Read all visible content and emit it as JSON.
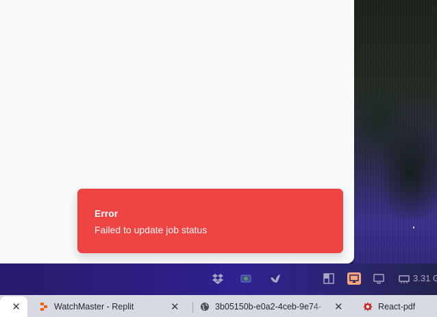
{
  "toast": {
    "title": "Error",
    "description": "Failed to update job status",
    "color": "#ef4444"
  },
  "tray": {
    "icons": [
      "dropbox-icon",
      "screen-capture-icon",
      "bird-icon",
      "window-layout-icon",
      "screen-mirror-icon",
      "display-icon",
      "memory-icon"
    ],
    "status_text": "3.31 G"
  },
  "tabs": [
    {
      "label": "",
      "close": "✕",
      "active": true
    },
    {
      "label": "WatchMaster - Replit",
      "close": "✕",
      "favicon": "replit-icon"
    },
    {
      "label": "3b05150b-e0a2-4ceb-9e74-",
      "close": "✕",
      "favicon": "globe-icon"
    },
    {
      "label": "React-pdf",
      "favicon": "react-pdf-icon"
    }
  ]
}
